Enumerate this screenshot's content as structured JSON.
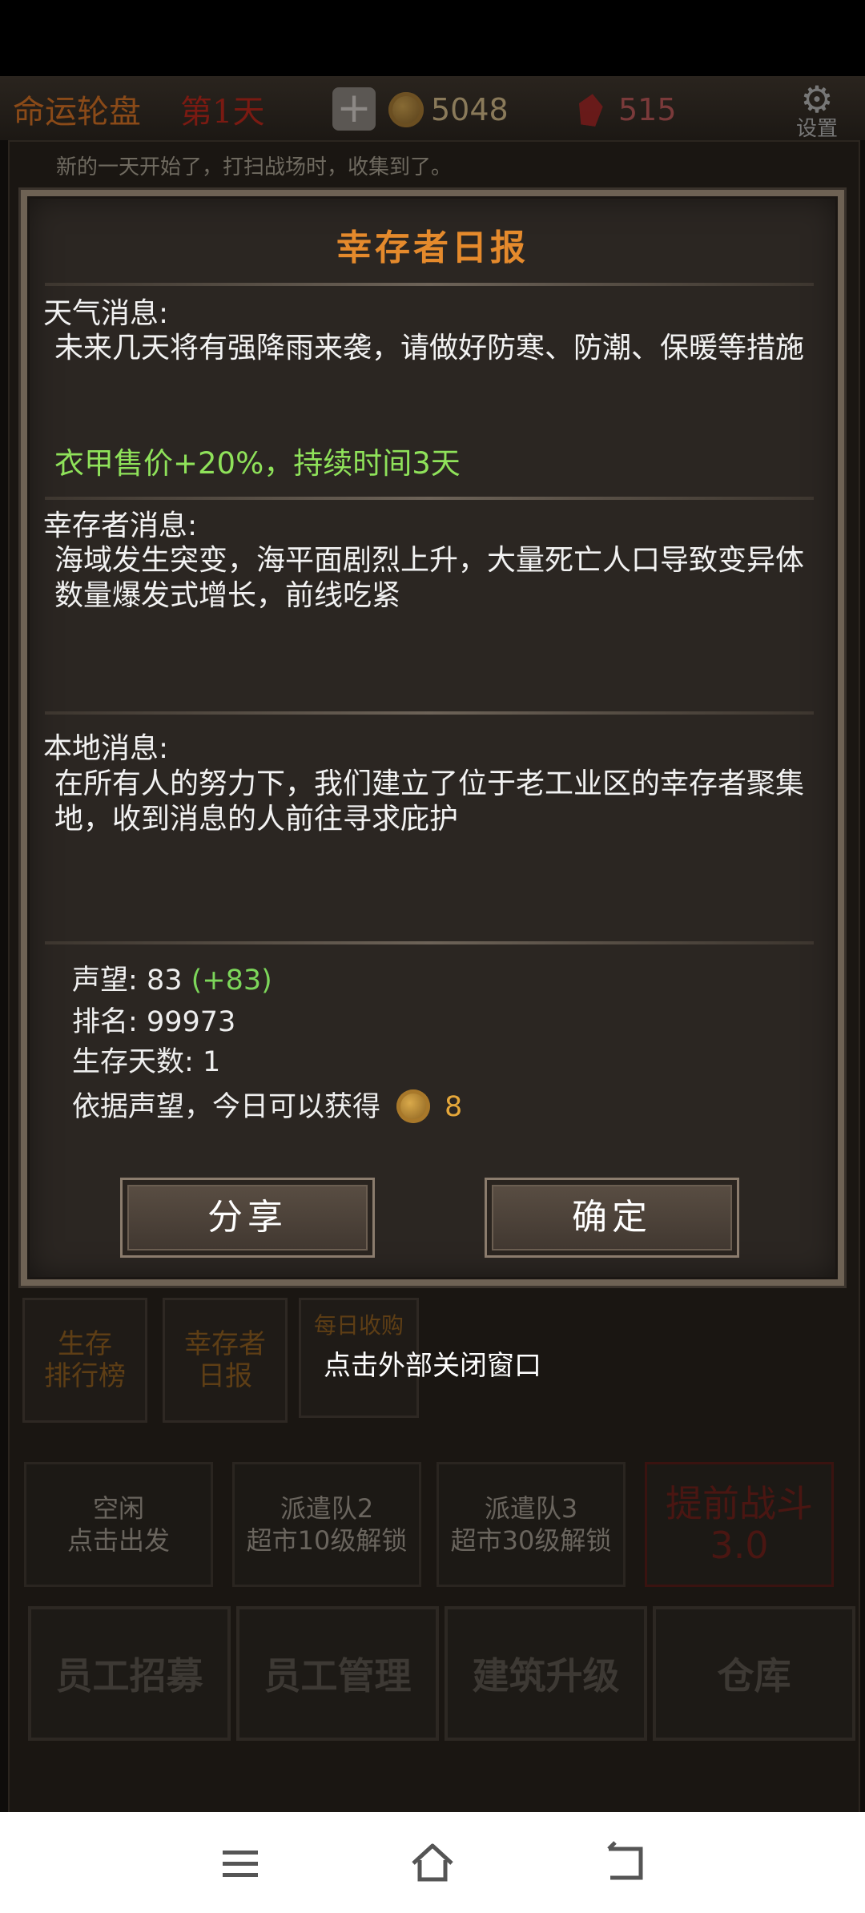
{
  "topbar": {
    "title": "命运轮盘",
    "day": "第1天",
    "plus_icon": "plus-icon",
    "gold": "5048",
    "gems": "515",
    "settings_label": "设置"
  },
  "log": {
    "line1": "新的一天开始了，打扫战场时，收集到了。"
  },
  "dialog": {
    "title": "幸存者日报",
    "weather": {
      "heading": "天气消息:",
      "text": "未来几天将有强降雨来袭，请做好防寒、防潮、保暖等措施",
      "effect": "衣甲售价+20%，持续时间3天"
    },
    "survivor": {
      "heading": "幸存者消息:",
      "text": "海域发生突变，海平面剧烈上升，大量死亡人口导致变异体数量爆发式增长，前线吃紧"
    },
    "local": {
      "heading": "本地消息:",
      "text": "在所有人的努力下，我们建立了位于老工业区的幸存者聚集地，收到消息的人前往寻求庇护"
    },
    "stats": {
      "reputation_label": "声望:",
      "reputation_value": "83",
      "reputation_delta": "(+83)",
      "rank_label": "排名:",
      "rank_value": "99973",
      "days_label": "生存天数:",
      "days_value": "1",
      "reward_label": "依据声望，今日可以获得",
      "reward_value": "8"
    },
    "share_label": "分享",
    "confirm_label": "确定"
  },
  "background": {
    "tabs": [
      "生存\n排行榜",
      "幸存者\n日报",
      "每日收购"
    ],
    "hint": "点击外部关闭窗口",
    "squads": [
      {
        "l1": "空闲",
        "l2": "点击出发"
      },
      {
        "l1": "派遣队2",
        "l2": "超市10级解锁"
      },
      {
        "l1": "派遣队3",
        "l2": "超市30级解锁"
      },
      {
        "l1": "提前战斗",
        "l2": "3.0"
      }
    ],
    "main_buttons": [
      "员工招募",
      "员工管理",
      "建筑升级",
      "仓库"
    ]
  },
  "navbar": {
    "icons": [
      "menu-icon",
      "home-icon",
      "back-icon"
    ]
  },
  "colors": {
    "accent": "#e58a2c",
    "effect_green": "#8fe25a",
    "delta_green": "#7cd65a",
    "gold": "#e5a73a"
  }
}
